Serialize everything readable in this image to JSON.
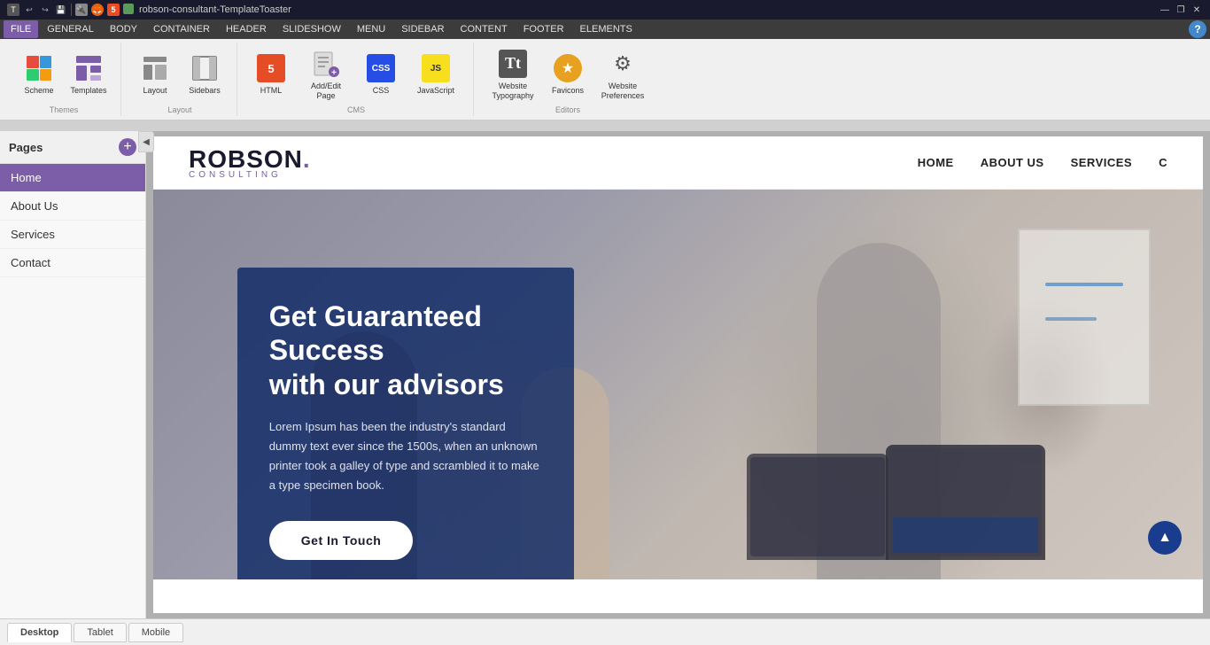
{
  "titlebar": {
    "title": "robson-consultant-TemplateToaster",
    "minimize": "—",
    "maximize": "❐",
    "close": "✕"
  },
  "menubar": {
    "items": [
      "FILE",
      "GENERAL",
      "BODY",
      "CONTAINER",
      "HEADER",
      "SLIDESHOW",
      "MENU",
      "SIDEBAR",
      "CONTENT",
      "FOOTER",
      "ELEMENTS"
    ]
  },
  "toolbar": {
    "groups": {
      "themes": {
        "label": "Themes",
        "buttons": [
          {
            "id": "scheme",
            "label": "Scheme"
          },
          {
            "id": "templates",
            "label": "Templates"
          }
        ]
      },
      "layout": {
        "label": "Layout",
        "buttons": [
          {
            "id": "layout",
            "label": "Layout"
          },
          {
            "id": "sidebars",
            "label": "Sidebars"
          }
        ]
      },
      "cms": {
        "label": "CMS",
        "buttons": [
          {
            "id": "html",
            "label": "HTML"
          },
          {
            "id": "add-edit-page",
            "label": "Add/Edit\nPage"
          },
          {
            "id": "css",
            "label": "CSS"
          },
          {
            "id": "javascript",
            "label": "JavaScript"
          }
        ]
      },
      "editors": {
        "label": "Editors",
        "buttons": [
          {
            "id": "website-typography",
            "label": "Website\nTypography"
          },
          {
            "id": "favicons",
            "label": "Favicons"
          },
          {
            "id": "website-preferences",
            "label": "Website\nPreferences"
          }
        ]
      }
    }
  },
  "sidebar": {
    "title": "Pages",
    "add_btn": "+",
    "pages": [
      {
        "id": "home",
        "label": "Home",
        "active": true
      },
      {
        "id": "about-us",
        "label": "About Us",
        "active": false
      },
      {
        "id": "services",
        "label": "Services",
        "active": false
      },
      {
        "id": "contact",
        "label": "Contact",
        "active": false
      }
    ]
  },
  "site": {
    "logo_main": "ROBSON.",
    "logo_sub": "CONSULTING",
    "nav_links": [
      "HOME",
      "ABOUT US",
      "SERVICES",
      "C"
    ],
    "hero_title": "Get Guaranteed Success\nwith our advisors",
    "hero_desc": "Lorem Ipsum has been the industry's standard dummy text ever since the 1500s, when an unknown printer took a galley of type and scrambled it to make a type specimen book.",
    "hero_btn": "Get In Touch"
  },
  "bottom": {
    "tabs": [
      "Desktop",
      "Tablet",
      "Mobile"
    ]
  },
  "colors": {
    "accent": "#7b5ea7",
    "nav_bg": "#1a3c8f",
    "hero_overlay": "rgba(15,40,100,0.82)"
  }
}
